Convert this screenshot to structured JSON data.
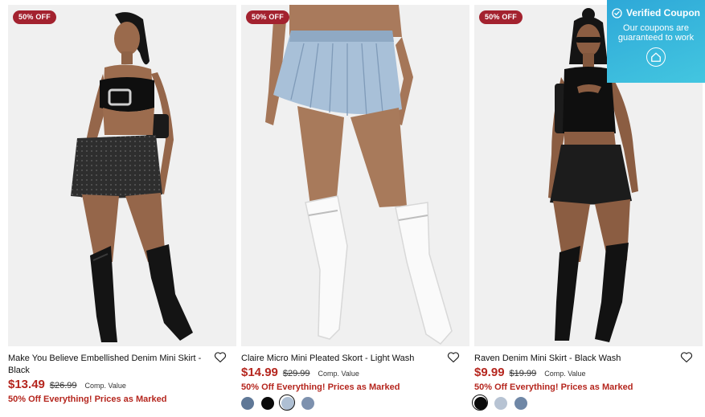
{
  "products": [
    {
      "badge": "50% OFF",
      "title": "Make You Believe Embellished Denim Mini Skirt - Black",
      "price": "$13.49",
      "was_price": "$26.99",
      "comp_label": "Comp. Value",
      "promo": "50% Off Everything! Prices as Marked",
      "swatches": []
    },
    {
      "badge": "50% OFF",
      "title": "Claire Micro Mini Pleated Skort - Light Wash",
      "price": "$14.99",
      "was_price": "$29.99",
      "comp_label": "Comp. Value",
      "promo": "50% Off Everything! Prices as Marked",
      "swatches": [
        "#5f7897",
        "#0a0a0a",
        "#aebfd3",
        "#7d91ae"
      ],
      "selected_swatch": 2
    },
    {
      "badge": "50% OFF",
      "title": "Raven Denim Mini Skirt - Black Wash",
      "price": "$9.99",
      "was_price": "$19.99",
      "comp_label": "Comp. Value",
      "promo": "50% Off Everything! Prices as Marked",
      "swatches": [
        "#0a0a0a",
        "#b7c3d3",
        "#6f87a6"
      ],
      "selected_swatch": 0
    }
  ],
  "coupon": {
    "title": "Verified Coupon",
    "text": "Our coupons are guaranteed to work"
  },
  "colors": {
    "sale_red": "#b5261e",
    "badge_red": "#a3222f",
    "coupon_blue": "#2ea8d8"
  }
}
